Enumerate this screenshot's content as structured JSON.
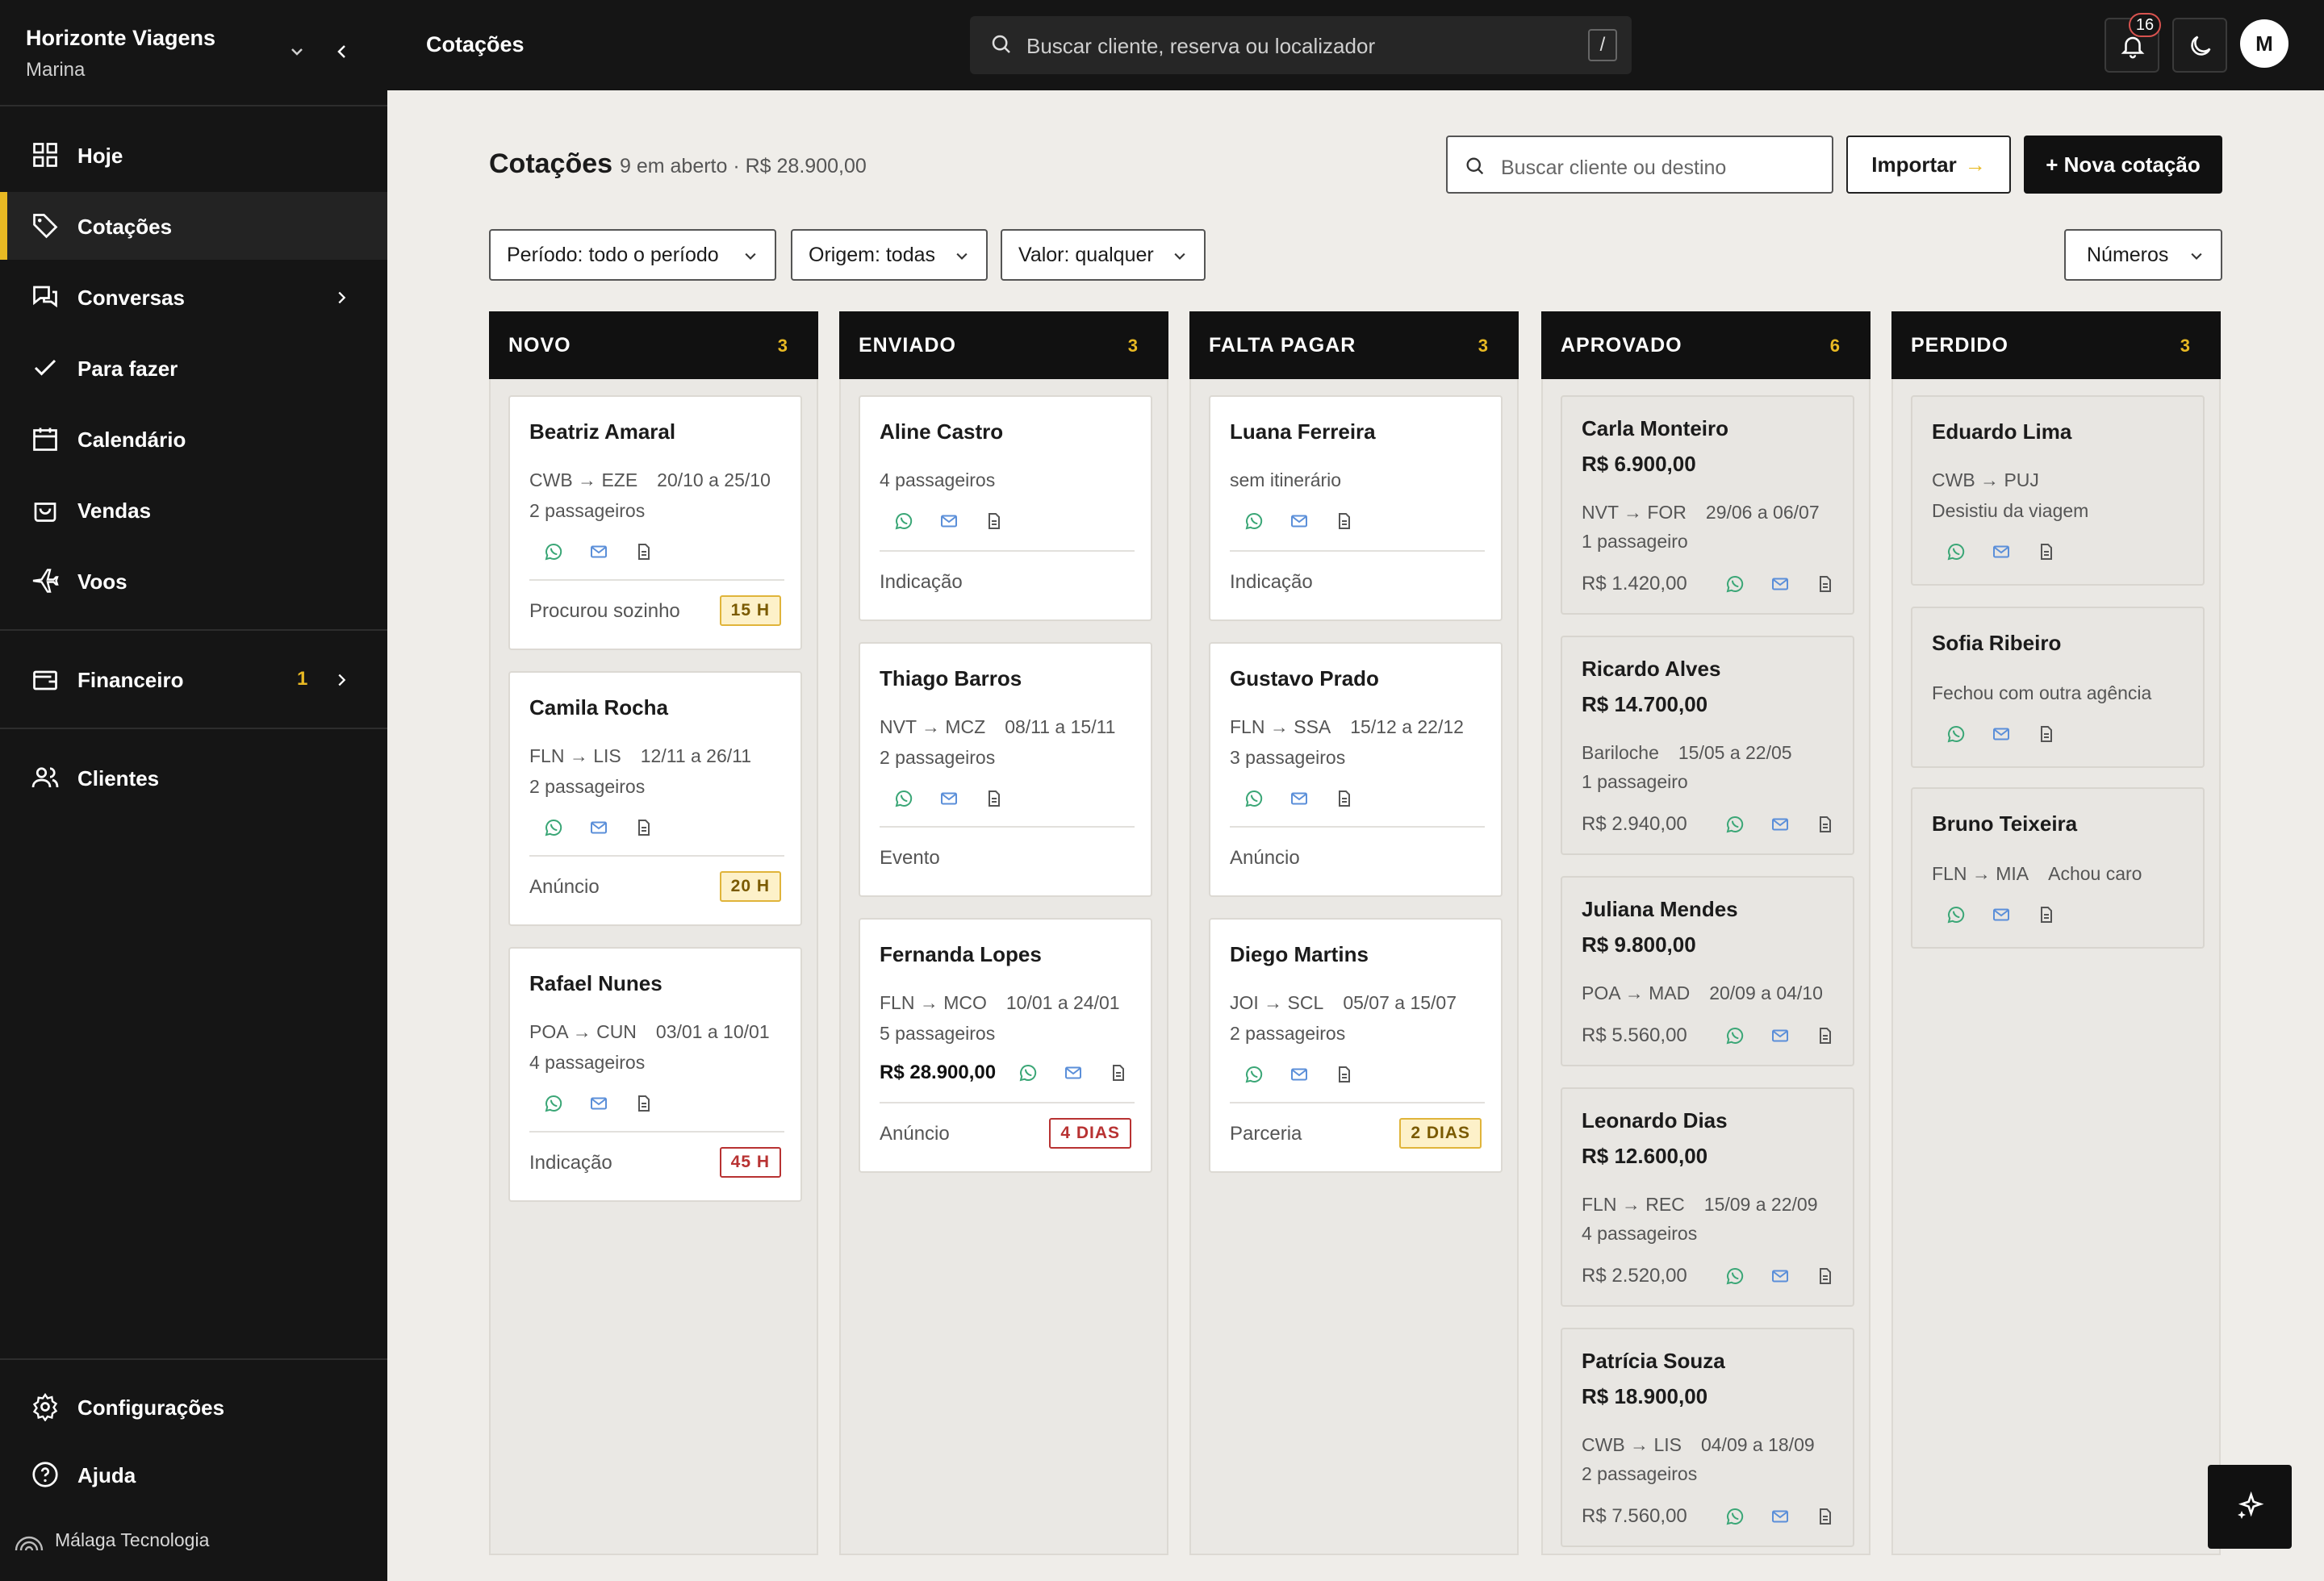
{
  "sidebar": {
    "brand_name": "Horizonte Viagens",
    "brand_user": "Marina",
    "nav": [
      {
        "label": "Hoje",
        "icon": "grid-icon"
      },
      {
        "label": "Cotações",
        "icon": "tag-icon",
        "active": true
      },
      {
        "label": "Conversas",
        "icon": "chat-icon"
      },
      {
        "label": "Para fazer",
        "icon": "check-icon"
      },
      {
        "label": "Calendário",
        "icon": "calendar-icon"
      },
      {
        "label": "Vendas",
        "icon": "bag-icon"
      },
      {
        "label": "Voos",
        "icon": "plane-icon"
      }
    ],
    "financeiro": {
      "label": "Financeiro",
      "count": "1",
      "icon": "wallet-icon"
    },
    "clientes": {
      "label": "Clientes",
      "icon": "users-icon"
    },
    "settings": {
      "label": "Configurações",
      "icon": "gear-icon"
    },
    "help": {
      "label": "Ajuda",
      "icon": "help-icon"
    },
    "org": "Málaga Tecnologia"
  },
  "topbar": {
    "title": "Cotações",
    "search_placeholder": "Buscar cliente, reserva ou localizador",
    "search_kbd": "/",
    "notifications": "16",
    "avatar": "M"
  },
  "header": {
    "title": "Cotações",
    "subtitle": "9 em aberto · R$ 28.900,00",
    "search_placeholder": "Buscar cliente ou destino",
    "import_label": "Importar",
    "import_arrow": "→",
    "new_label": "+ Nova cotação"
  },
  "filters": {
    "periodo": "Período: todo o período",
    "origem": "Origem: todas",
    "valor": "Valor: qualquer",
    "numeros": "Números"
  },
  "colors": {
    "accent": "#e8b923",
    "dark": "#151515",
    "whatsapp": "#3aa676",
    "mail": "#5b8fd9"
  },
  "columns": [
    {
      "title": "NOVO",
      "count": "3",
      "cards": [
        {
          "name": "Beatriz Amaral",
          "route": "CWB → EZE",
          "dates": "20/10 a 25/10",
          "pax": "2 passageiros",
          "source": "Procurou sozinho",
          "tag": "15 H"
        },
        {
          "name": "Camila Rocha",
          "route": "FLN → LIS",
          "dates": "12/11 a 26/11",
          "pax": "2 passageiros",
          "source": "Anúncio",
          "tag": "20 H"
        },
        {
          "name": "Rafael Nunes",
          "route": "POA → CUN",
          "dates": "03/01 a 10/01",
          "pax": "4 passageiros",
          "source": "Indicação",
          "tag": "45 H"
        }
      ]
    },
    {
      "title": "ENVIADO",
      "count": "3",
      "cards": [
        {
          "name": "Aline Castro",
          "pax": "4 passageiros",
          "source": "Indicação"
        },
        {
          "name": "Thiago Barros",
          "route": "NVT → MCZ",
          "dates": "08/11 a 15/11",
          "pax": "2 passageiros",
          "source": "Evento"
        },
        {
          "name": "Fernanda Lopes",
          "route": "FLN → MCO",
          "dates": "10/01 a 24/01",
          "pax": "5 passageiros",
          "amount": "R$ 28.900,00",
          "source": "Anúncio",
          "tag": "4 DIAS"
        }
      ]
    },
    {
      "title": "FALTA PAGAR",
      "count": "3",
      "cards": [
        {
          "name": "Luana Ferreira",
          "pax": "sem itinerário",
          "source": "Indicação"
        },
        {
          "name": "Gustavo Prado",
          "route": "FLN → SSA",
          "dates": "15/12 a 22/12",
          "pax": "3 passageiros",
          "source": "Anúncio"
        },
        {
          "name": "Diego Martins",
          "route": "JOI → SCL",
          "dates": "05/07 a 15/07",
          "pax": "2 passageiros",
          "source": "Parceria",
          "tag": "2 DIAS"
        }
      ]
    },
    {
      "title": "APROVADO",
      "count": "6",
      "cards": [
        {
          "name": "Carla Monteiro",
          "value": "R$ 6.900,00",
          "route": "NVT → FOR",
          "dates": "29/06 a 06/07",
          "pax": "1 passageiro",
          "amount": "R$ 1.420,00"
        },
        {
          "name": "Ricardo Alves",
          "value": "R$ 14.700,00",
          "route": "Bariloche",
          "dates": "15/05 a 22/05",
          "pax": "1 passageiro",
          "amount": "R$ 2.940,00"
        },
        {
          "name": "Juliana Mendes",
          "value": "R$ 9.800,00",
          "route": "POA → MAD",
          "dates": "20/09 a 04/10",
          "amount": "R$ 5.560,00"
        },
        {
          "name": "Leonardo Dias",
          "value": "R$ 12.600,00",
          "route": "FLN → REC",
          "dates": "15/09 a 22/09",
          "pax": "4 passageiros",
          "amount": "R$ 2.520,00"
        },
        {
          "name": "Patrícia Souza",
          "value": "R$ 18.900,00",
          "route": "CWB → LIS",
          "dates": "04/09 a 18/09",
          "pax": "2 passageiros",
          "amount": "R$ 7.560,00"
        }
      ]
    },
    {
      "title": "PERDIDO",
      "count": "3",
      "cards": [
        {
          "name": "Eduardo Lima",
          "route": "CWB → PUJ",
          "reason": "Desistiu da viagem"
        },
        {
          "name": "Sofia Ribeiro",
          "reason": "Fechou com outra agência"
        },
        {
          "name": "Bruno Teixeira",
          "route": "FLN → MIA",
          "dates": "Achou caro"
        }
      ]
    }
  ]
}
